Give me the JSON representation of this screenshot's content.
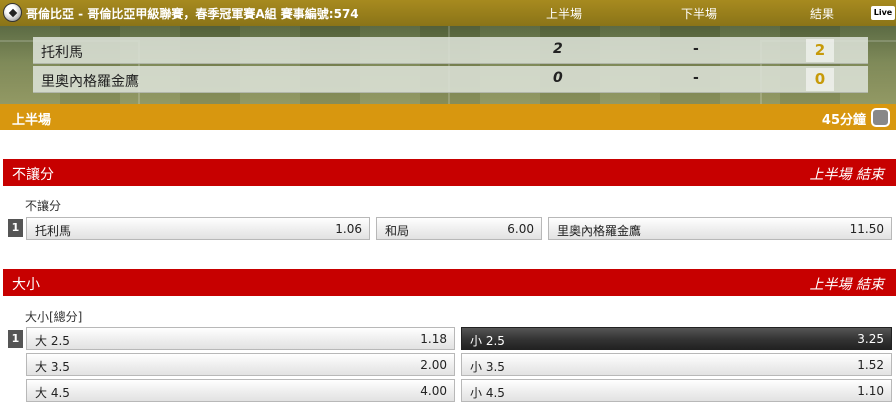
{
  "header": {
    "match_title": "哥倫比亞 - 哥倫比亞甲級聯賽，春季冠軍賽A組 賽事編號:574",
    "col_first_half": "上半場",
    "col_second_half": "下半場",
    "col_result": "結果",
    "live_label": "Live"
  },
  "teams": [
    {
      "name": "托利馬",
      "first_half": "2",
      "second_half": "-",
      "total": "2"
    },
    {
      "name": "里奧內格羅金鷹",
      "first_half": "0",
      "second_half": "-",
      "total": "0"
    }
  ],
  "status": {
    "period": "上半場",
    "clock": "45分鐘"
  },
  "markets": [
    {
      "name": "不讓分",
      "status": "上半場 結束",
      "sub_label": "不讓分",
      "row_number": "1",
      "options": [
        {
          "label": "托利馬",
          "odds": "1.06"
        },
        {
          "label": "和局",
          "odds": "6.00"
        },
        {
          "label": "里奧內格羅金鷹",
          "odds": "11.50"
        }
      ]
    },
    {
      "name": "大小",
      "status": "上半場 結束",
      "sub_label": "大小[總分]",
      "row_number": "1",
      "rows": [
        {
          "over_label": "大 2.5",
          "over_odds": "1.18",
          "under_label": "小 2.5",
          "under_odds": "3.25",
          "under_selected": true
        },
        {
          "over_label": "大 3.5",
          "over_odds": "2.00",
          "under_label": "小 3.5",
          "under_odds": "1.52",
          "under_selected": false
        },
        {
          "over_label": "大 4.5",
          "over_odds": "4.00",
          "under_label": "小 4.5",
          "under_odds": "1.10",
          "under_selected": false
        }
      ]
    }
  ]
}
